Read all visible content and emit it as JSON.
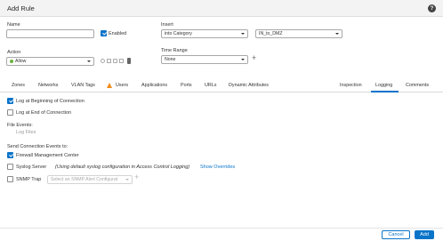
{
  "dialog": {
    "title": "Add Rule"
  },
  "form": {
    "name_label": "Name",
    "name_value": "",
    "enabled_label": "Enabled",
    "enabled_checked": true,
    "insert_label": "Insert",
    "insert_value": "into Category",
    "insert_target_value": "IN_to_DMZ",
    "action_label": "Action",
    "action_value": "Allow",
    "action_color": "#6db33f",
    "time_range_label": "Time Range",
    "time_range_value": "None"
  },
  "tabs": [
    {
      "label": "Zones"
    },
    {
      "label": "Networks"
    },
    {
      "label": "VLAN Tags"
    },
    {
      "label": "Users",
      "warning": true
    },
    {
      "label": "Applications"
    },
    {
      "label": "Ports"
    },
    {
      "label": "URLs"
    },
    {
      "label": "Dynamic Attributes"
    },
    {
      "label": "Inspection"
    },
    {
      "label": "Logging",
      "active": true
    },
    {
      "label": "Comments"
    }
  ],
  "logging": {
    "log_beginning_label": "Log at Beginning of Connection",
    "log_beginning_checked": true,
    "log_end_label": "Log at End of Connection",
    "log_end_checked": false,
    "file_events_label": "File Events:",
    "log_files_label": "Log Files",
    "send_events_label": "Send Connection Events to:",
    "fmc_label": "Firewall Management Center",
    "fmc_checked": true,
    "syslog_label": "Syslog Server",
    "syslog_checked": false,
    "syslog_note": "(Using default syslog configuration in Access Control Logging)",
    "show_overrides_label": "Show Overrides",
    "snmp_label": "SNMP Trap",
    "snmp_checked": false,
    "snmp_select_placeholder": "Select an SNMP Alert Configurat"
  },
  "footer": {
    "cancel_label": "Cancel",
    "add_label": "Add"
  },
  "colors": {
    "accent": "#0a74c9",
    "warning": "#f08c1a"
  }
}
